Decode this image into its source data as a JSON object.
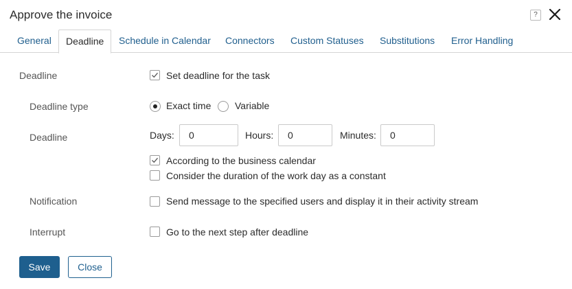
{
  "dialog": {
    "title": "Approve the invoice",
    "help_label": "?"
  },
  "tabs": [
    {
      "label": "General",
      "active": false
    },
    {
      "label": "Deadline",
      "active": true
    },
    {
      "label": "Schedule in Calendar",
      "active": false
    },
    {
      "label": "Connectors",
      "active": false
    },
    {
      "label": "Custom Statuses",
      "active": false
    },
    {
      "label": "Substitutions",
      "active": false
    },
    {
      "label": "Error Handling",
      "active": false
    }
  ],
  "form": {
    "deadline_label": "Deadline",
    "set_deadline": {
      "label": "Set deadline for the task",
      "checked": true
    },
    "deadline_type_label": "Deadline type",
    "deadline_type_options": [
      {
        "label": "Exact time",
        "selected": true
      },
      {
        "label": "Variable",
        "selected": false
      }
    ],
    "deadline_values_label": "Deadline",
    "days": {
      "label": "Days:",
      "value": "0"
    },
    "hours": {
      "label": "Hours:",
      "value": "0"
    },
    "minutes": {
      "label": "Minutes:",
      "value": "0"
    },
    "business_calendar": {
      "label": "According to the business calendar",
      "checked": true
    },
    "work_day_constant": {
      "label": "Consider the duration of the work day as a constant",
      "checked": false
    },
    "notification_label": "Notification",
    "send_message": {
      "label": "Send message to the specified users and display it in their activity stream",
      "checked": false
    },
    "interrupt_label": "Interrupt",
    "next_step": {
      "label": "Go to the next step after deadline",
      "checked": false
    }
  },
  "footer": {
    "save_label": "Save",
    "close_label": "Close"
  },
  "colors": {
    "accent": "#1e5f8e",
    "tab_link": "#1f5e8d"
  }
}
